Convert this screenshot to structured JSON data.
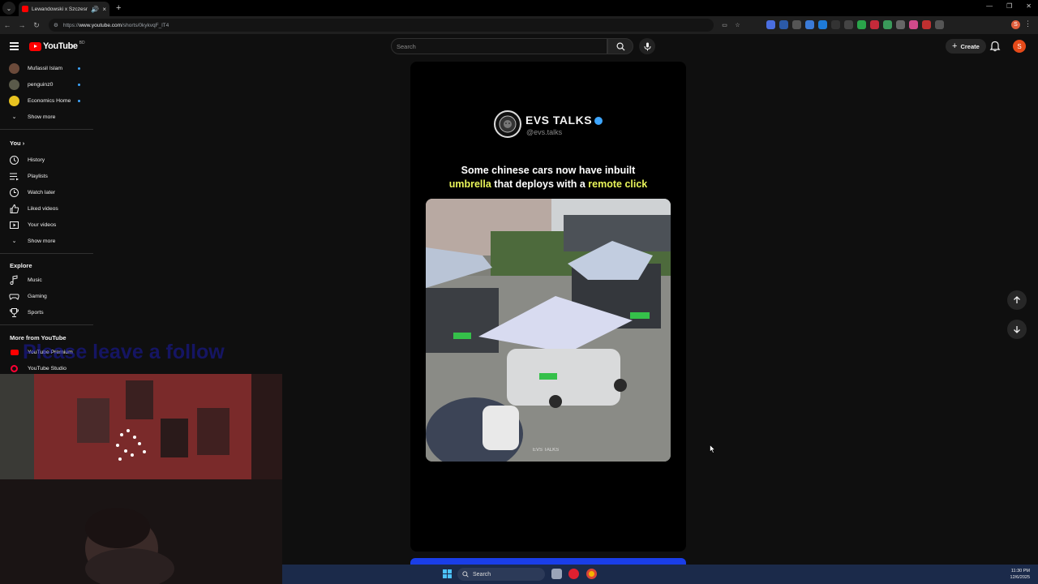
{
  "browser": {
    "tab_title": "Lewandowski x Szczesny x",
    "url_prefix": "https://",
    "url_host": "www.youtube.com",
    "url_path": "/shorts/0kykvqF_lT4"
  },
  "header": {
    "logo_text": "YouTube",
    "country_code": "BD",
    "search_placeholder": "Search",
    "create_label": "Create",
    "avatar_initial": "S"
  },
  "sidebar": {
    "subscriptions": [
      {
        "label": "Mufassil Islam",
        "color": "#6b4a3a"
      },
      {
        "label": "penguinz0",
        "color": "#5a5a4a"
      },
      {
        "label": "Economics Home",
        "color": "#e8c320"
      }
    ],
    "show_more_1": "Show more",
    "you_heading": "You",
    "you_items": [
      {
        "label": "History",
        "icon": "history-icon"
      },
      {
        "label": "Playlists",
        "icon": "playlists-icon"
      },
      {
        "label": "Watch later",
        "icon": "watch-later-icon"
      },
      {
        "label": "Liked videos",
        "icon": "like-icon"
      },
      {
        "label": "Your videos",
        "icon": "your-videos-icon"
      }
    ],
    "show_more_2": "Show more",
    "explore_heading": "Explore",
    "explore_items": [
      {
        "label": "Music",
        "icon": "music-icon"
      },
      {
        "label": "Gaming",
        "icon": "gaming-icon"
      },
      {
        "label": "Sports",
        "icon": "trophy-icon"
      }
    ],
    "more_heading": "More from YouTube",
    "more_items": [
      {
        "label": "YouTube Premium",
        "icon": "youtube-premium-icon"
      },
      {
        "label": "YouTube Studio",
        "icon": "youtube-studio-icon"
      }
    ]
  },
  "short": {
    "channel_name": "EVS TALKS",
    "channel_handle": "@evs.talks",
    "caption_line1": "Some chinese cars now have inbuilt",
    "caption_hl1": "umbrella",
    "caption_mid": " that deploys with a ",
    "caption_hl2": "remote click",
    "video_watermark": "EVS TALKS",
    "accent_color": "#e9f55a"
  },
  "overlay": {
    "stream_text": "Please leave a follow"
  },
  "taskbar": {
    "search_label": "Search",
    "time": "11:30 PM",
    "date": "12/6/2025"
  }
}
